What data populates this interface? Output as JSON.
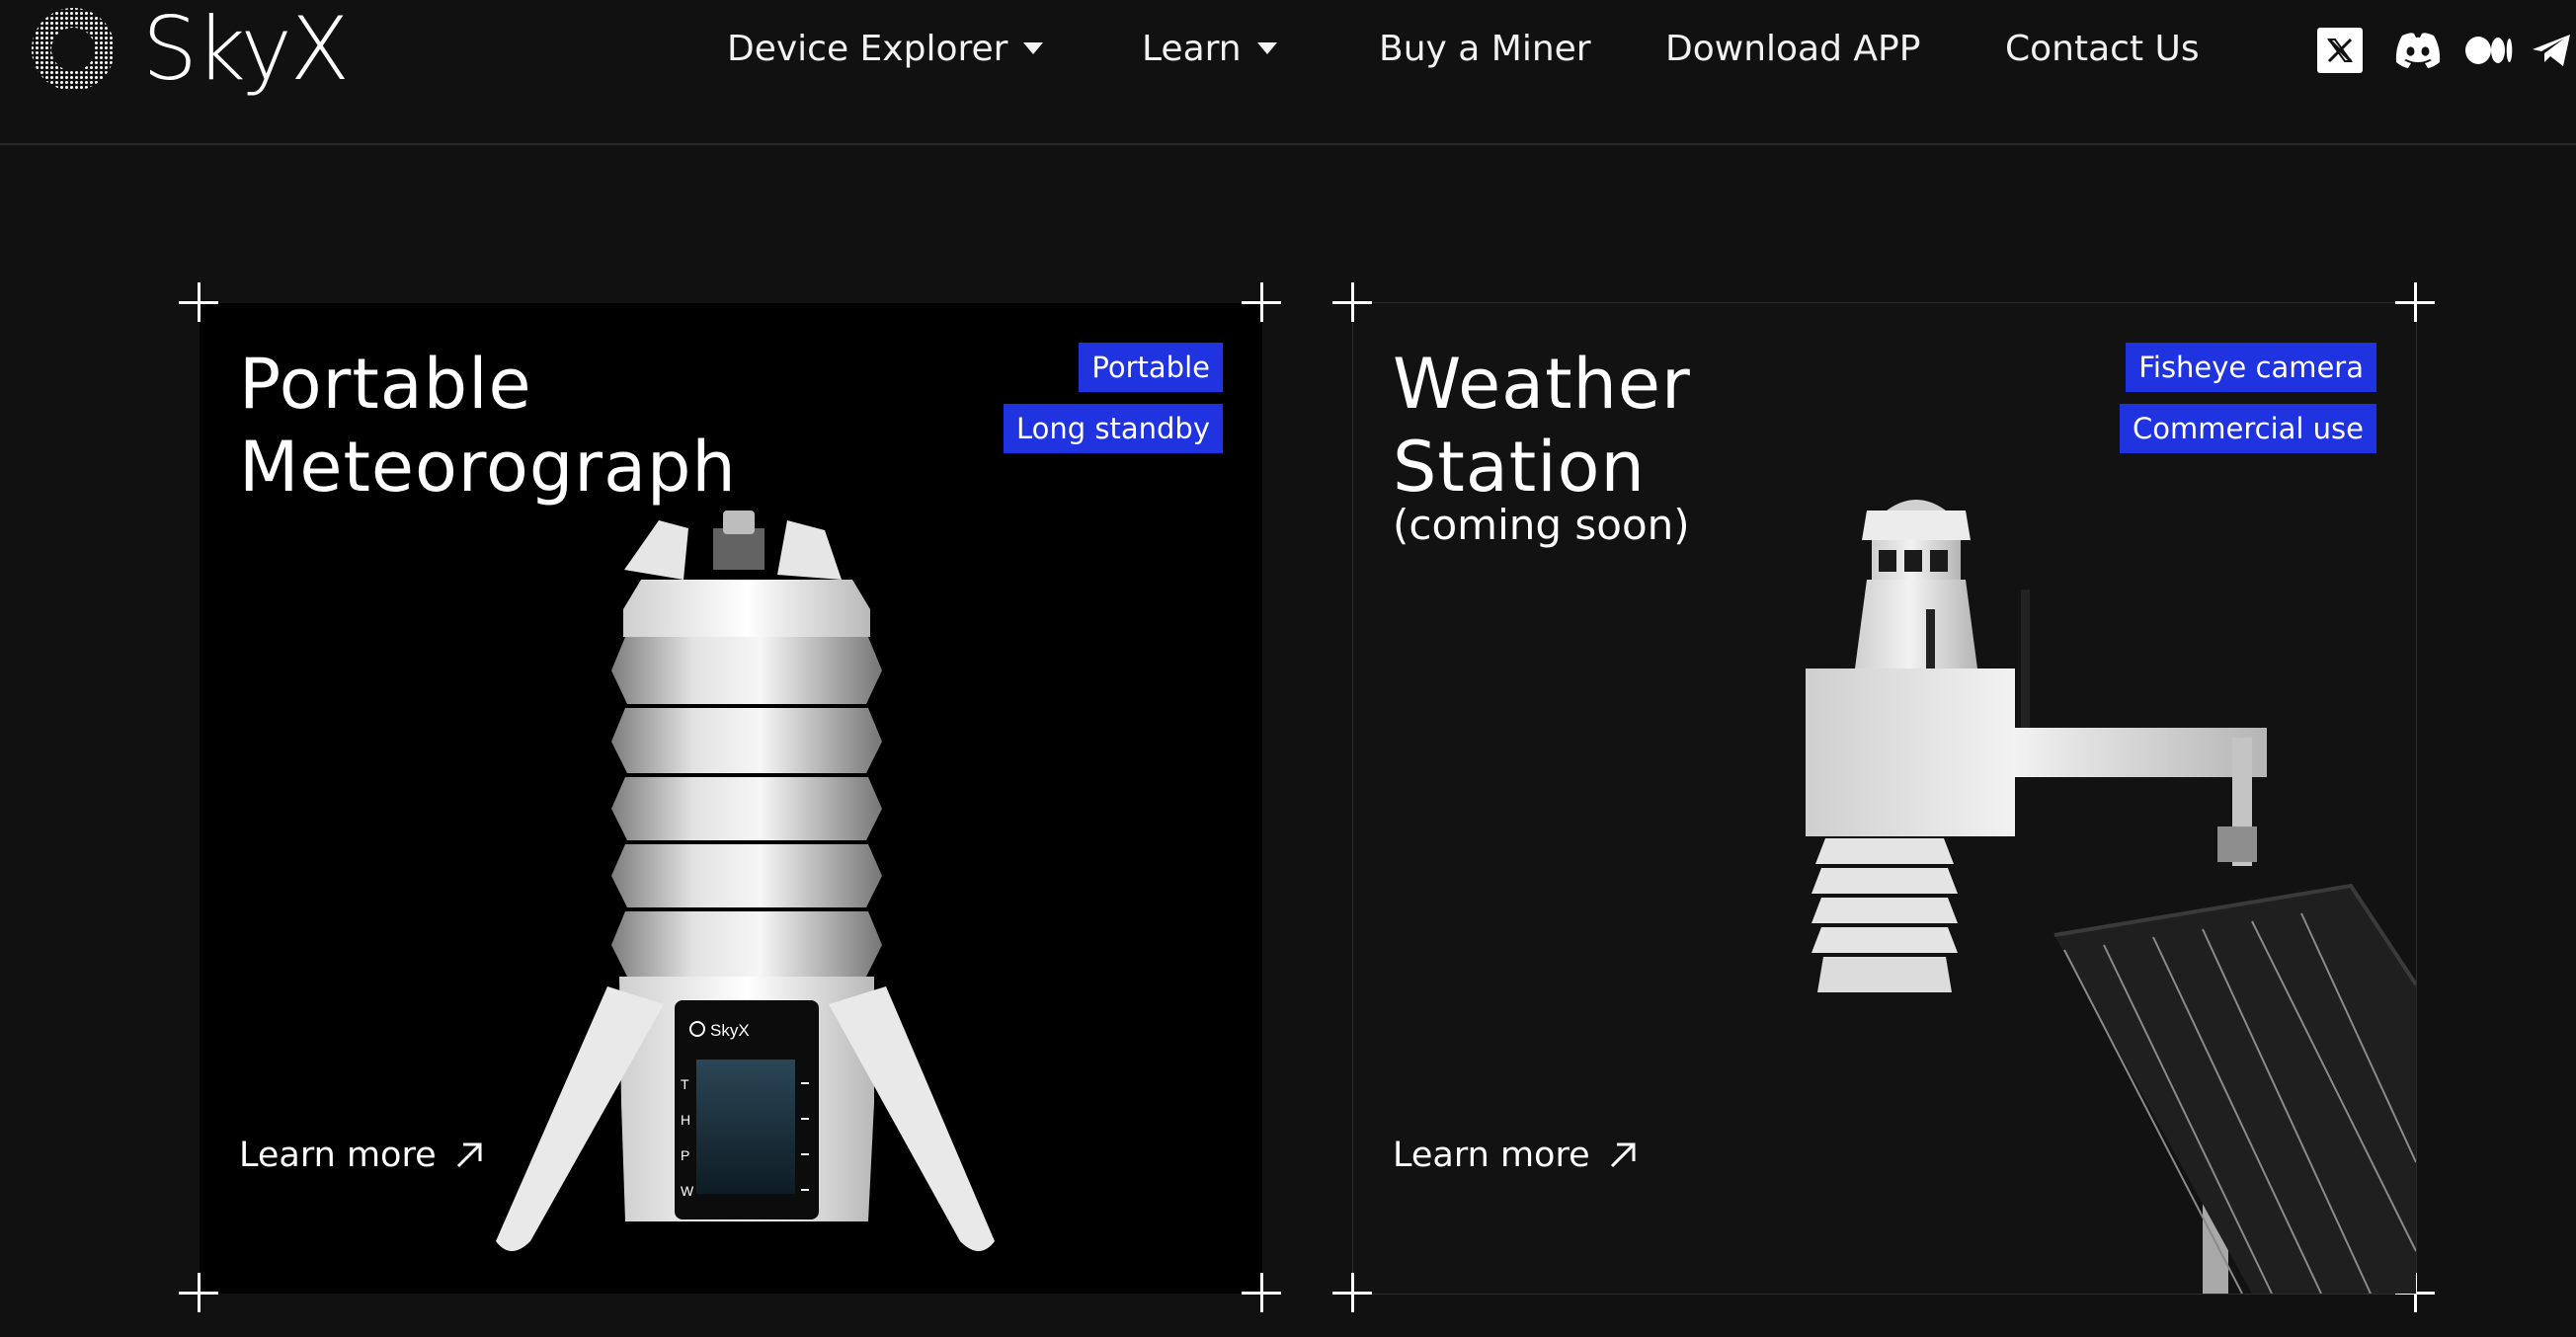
{
  "header": {
    "brand": "SkyX",
    "nav": [
      {
        "label": "Device Explorer",
        "dropdown": true
      },
      {
        "label": "Learn",
        "dropdown": true
      },
      {
        "label": "Buy a Miner",
        "dropdown": false
      },
      {
        "label": "Download APP",
        "dropdown": false
      },
      {
        "label": "Contact Us",
        "dropdown": false
      }
    ],
    "social_icons": [
      "x-icon",
      "discord-icon",
      "medium-icon",
      "telegram-icon"
    ]
  },
  "cards": [
    {
      "title_line1": "Portable",
      "title_line2": "Meteorograph",
      "subtitle": "",
      "badges": [
        "Portable",
        "Long standby"
      ],
      "learn_more": "Learn more",
      "device_brand": "SkyX",
      "display_letters": [
        "T",
        "H",
        "P",
        "W"
      ]
    },
    {
      "title_line1": "Weather",
      "title_line2": "Station",
      "subtitle": "(coming soon)",
      "badges": [
        "Fisheye camera",
        "Commercial use"
      ],
      "learn_more": "Learn more"
    }
  ],
  "colors": {
    "background": "#111111",
    "card_left": "#000000",
    "badge": "#1f33e0",
    "text": "#ffffff"
  }
}
